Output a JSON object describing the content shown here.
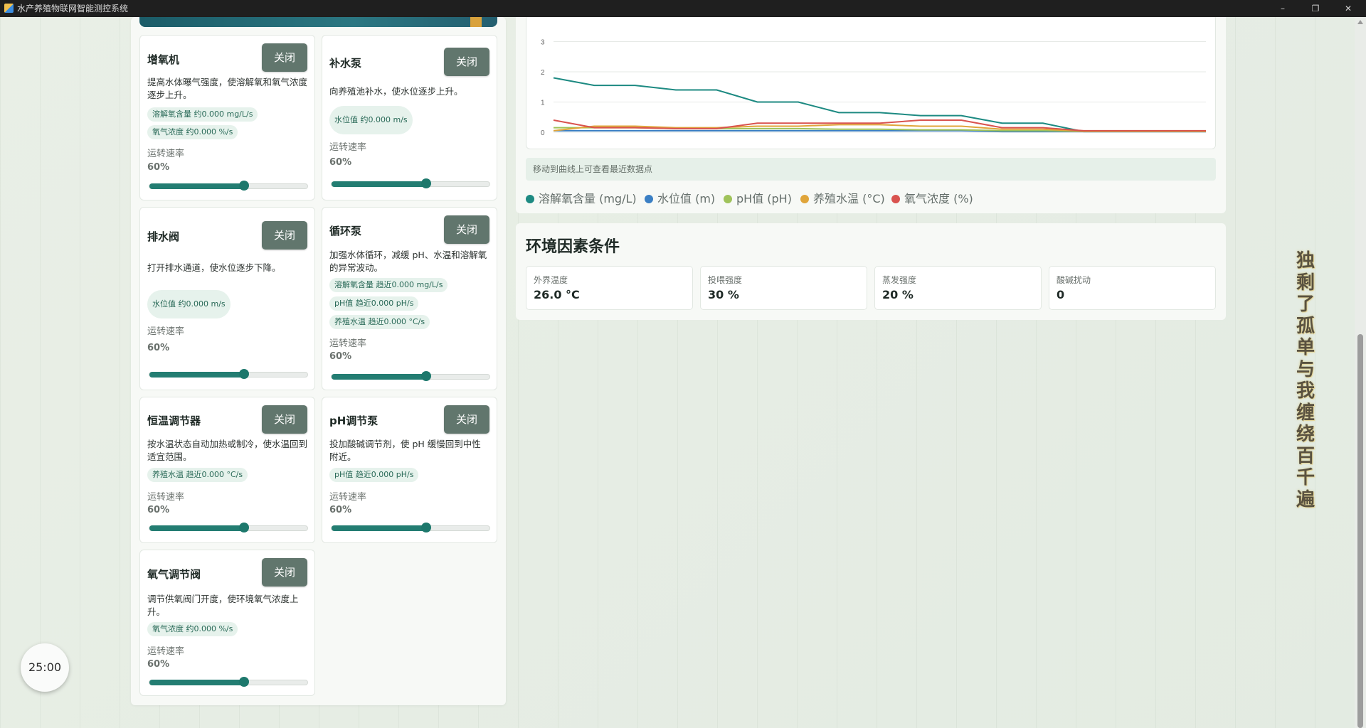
{
  "window": {
    "title": "水产养殖物联网智能测控系统",
    "controls": [
      "–",
      "❐",
      "✕"
    ]
  },
  "devices": [
    {
      "name": "增氧机",
      "button": "关闭",
      "description": "提高水体曝气强度，使溶解氧和氧气浓度逐步上升。",
      "effects": [
        "溶解氧含量 约0.000 mg/L/s",
        "氧气浓度 约0.000 %/s"
      ],
      "speed_label": "运转速率",
      "speed_value": "60%",
      "speed": 0.6
    },
    {
      "name": "补水泵",
      "button": "关闭",
      "description": "向养殖池补水，使水位逐步上升。",
      "effects": [
        "水位值 约0.000 m/s"
      ],
      "speed_label": "运转速率",
      "speed_value": "60%",
      "speed": 0.6
    },
    {
      "name": "排水阀",
      "button": "关闭",
      "description": "打开排水通道，使水位逐步下降。",
      "effects": [
        "水位值 约0.000 m/s"
      ],
      "speed_label": "运转速率",
      "speed_value": "60%",
      "speed": 0.6
    },
    {
      "name": "循环泵",
      "button": "关闭",
      "description": "加强水体循环，减缓 pH、水温和溶解氧的异常波动。",
      "effects": [
        "溶解氧含量 趋近0.000 mg/L/s",
        "pH值 趋近0.000 pH/s",
        "养殖水温 趋近0.000 °C/s"
      ],
      "speed_label": "运转速率",
      "speed_value": "60%",
      "speed": 0.6
    },
    {
      "name": "恒温调节器",
      "button": "关闭",
      "description": "按水温状态自动加热或制冷，使水温回到适宜范围。",
      "effects": [
        "养殖水温 趋近0.000 °C/s"
      ],
      "speed_label": "运转速率",
      "speed_value": "60%",
      "speed": 0.6
    },
    {
      "name": "pH调节泵",
      "button": "关闭",
      "description": "投加酸碱调节剂，使 pH 缓慢回到中性附近。",
      "effects": [
        "pH值 趋近0.000 pH/s"
      ],
      "speed_label": "运转速率",
      "speed_value": "60%",
      "speed": 0.6
    },
    {
      "name": "氧气调节阀",
      "button": "关闭",
      "description": "调节供氧阀门开度，使环境氧气浓度上升。",
      "effects": [
        "氧气浓度 约0.000 %/s"
      ],
      "speed_label": "运转速率",
      "speed_value": "60%",
      "speed": 0.6
    }
  ],
  "chart": {
    "hover_hint": "移动到曲线上可查看最近数据点",
    "legend": [
      {
        "label": "溶解氧含量 (mg/L)",
        "color": "#1d8a82"
      },
      {
        "label": "水位值 (m)",
        "color": "#3a7fc4"
      },
      {
        "label": "pH值 (pH)",
        "color": "#9fc35a"
      },
      {
        "label": "养殖水温 (°C)",
        "color": "#e0a53a"
      },
      {
        "label": "氧气浓度 (%)",
        "color": "#d9534f"
      }
    ]
  },
  "chart_data": {
    "type": "line",
    "title": "",
    "xlabel": "",
    "ylabel": "",
    "ylim": [
      0,
      3.5
    ],
    "yticks": [
      "0",
      "1",
      "2",
      "3"
    ],
    "x": [
      0,
      1,
      2,
      3,
      4,
      5,
      6,
      7,
      8,
      9,
      10,
      11,
      12,
      13,
      14,
      15,
      16
    ],
    "series": [
      {
        "name": "溶解氧含量 (mg/L)",
        "color": "#1d8a82",
        "values": [
          1.8,
          1.55,
          1.55,
          1.4,
          1.4,
          1.0,
          1.0,
          0.65,
          0.65,
          0.55,
          0.55,
          0.3,
          0.3,
          0.02,
          0.02,
          0.02,
          0.02
        ]
      },
      {
        "name": "水位值 (m)",
        "color": "#3a7fc4",
        "values": [
          0.05,
          0.05,
          0.05,
          0.05,
          0.05,
          0.05,
          0.05,
          0.05,
          0.05,
          0.05,
          0.05,
          0.02,
          0.02,
          0.02,
          0.02,
          0.02,
          0.02
        ]
      },
      {
        "name": "pH值 (pH)",
        "color": "#9fc35a",
        "values": [
          0.15,
          0.15,
          0.15,
          0.12,
          0.12,
          0.12,
          0.12,
          0.1,
          0.1,
          0.08,
          0.08,
          0.05,
          0.05,
          0.03,
          0.03,
          0.03,
          0.03
        ]
      },
      {
        "name": "养殖水温 (°C)",
        "color": "#e0a53a",
        "values": [
          0.05,
          0.2,
          0.2,
          0.15,
          0.15,
          0.2,
          0.2,
          0.25,
          0.25,
          0.2,
          0.2,
          0.1,
          0.1,
          0.03,
          0.03,
          0.03,
          0.03
        ]
      },
      {
        "name": "氧气浓度 (%)",
        "color": "#d9534f",
        "values": [
          0.4,
          0.15,
          0.15,
          0.12,
          0.12,
          0.3,
          0.3,
          0.3,
          0.3,
          0.4,
          0.4,
          0.15,
          0.15,
          0.05,
          0.05,
          0.05,
          0.05
        ]
      }
    ]
  },
  "environment": {
    "title": "环境因素条件",
    "items": [
      {
        "label": "外界温度",
        "value": "26.0 °C"
      },
      {
        "label": "投喂强度",
        "value": "30 %"
      },
      {
        "label": "蒸发强度",
        "value": "20 %"
      },
      {
        "label": "酸碱扰动",
        "value": "0"
      }
    ]
  },
  "timer": {
    "value": "25:00"
  },
  "decoration": {
    "vertical_text": "独剩了孤单与我缠绕百千遍"
  }
}
